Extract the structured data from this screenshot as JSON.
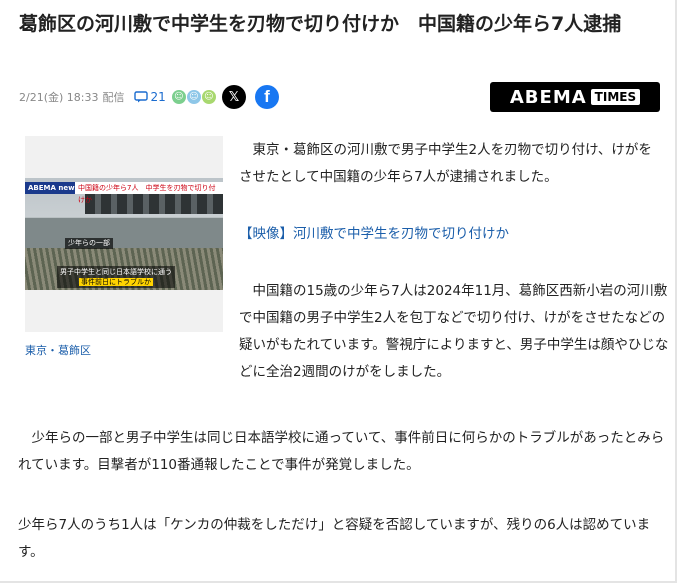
{
  "article": {
    "title": "葛飾区の河川敷で中学生を刃物で切り付けか　中国籍の少年ら7人逮捕",
    "date": "2/21(金) 18:33",
    "delivery": "配信",
    "comment_count": "21",
    "share_x": "𝕏",
    "share_facebook": "f",
    "logo_main": "ABEMA",
    "logo_sub": "TIMES",
    "image": {
      "tag": "ABEMA news/",
      "headline": "中国籍の少年ら7人　中学生を刃物で切り付けか",
      "sub1": "少年らの一部",
      "sub2_line1": "男子中学生と同じ日本語学校に通う",
      "sub2_line2": "事件前日にトラブルか"
    },
    "image_caption": "東京・葛飾区",
    "paragraph1": "　東京・葛飾区の河川敷で男子中学生2人を刃物で切り付け、けがをさせたとして中国籍の少年ら7人が逮捕されました。",
    "video_link": "【映像】河川敷で中学生を刃物で切り付けか",
    "paragraph2": "　中国籍の15歳の少年ら7人は2024年11月、葛飾区西新小岩の河川敷で中国籍の男子中学生2人を包丁などで切り付け、けがをさせたなどの疑いがもたれています。警視庁によりますと、男子中学生は顔やひじなどに全治2週間のけがをしました。",
    "paragraph3": "　少年らの一部と男子中学生は同じ日本語学校に通っていて、事件前日に何らかのトラブルがあったとみられています。目撃者が110番通報したことで事件が発覚しました。",
    "paragraph4": "少年ら7人のうち1人は「ケンカの仲裁をしただけ」と容疑を否認していますが、残りの6人は認めています。"
  },
  "colors": {
    "accent_link": "#1b5eaa",
    "facebook": "#1877f2",
    "logo_bg": "#000000"
  },
  "icons": [
    "comment-icon",
    "reaction-face-icon",
    "x-share-icon",
    "facebook-share-icon"
  ]
}
